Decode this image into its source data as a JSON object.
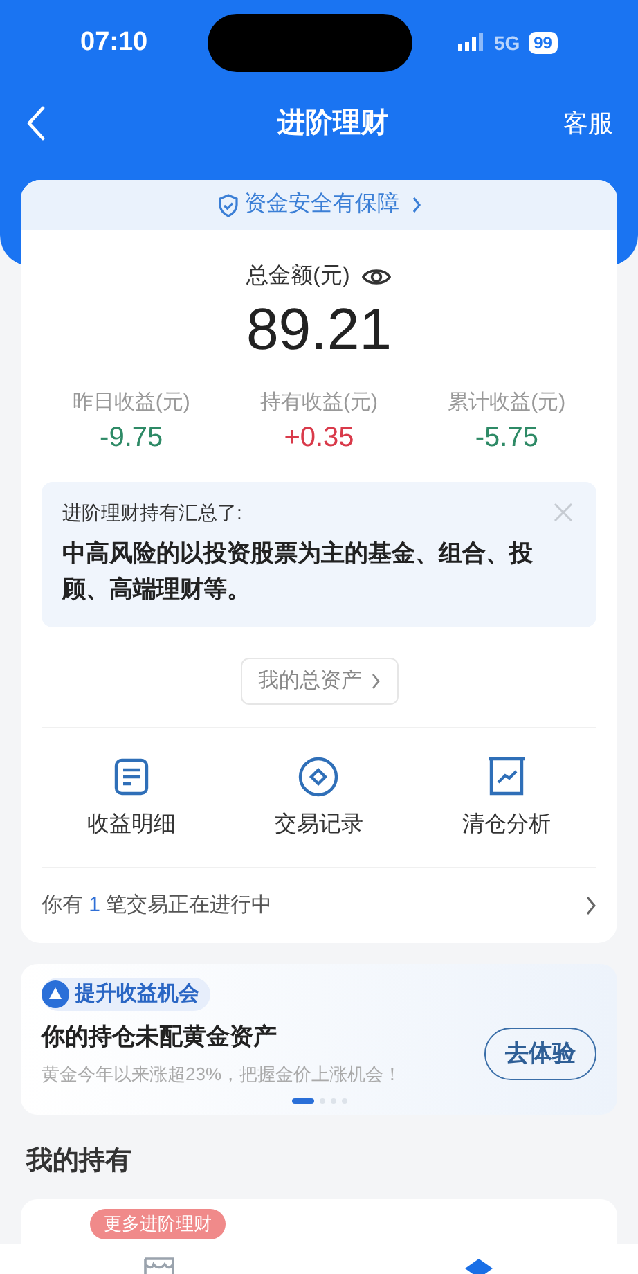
{
  "status_bar": {
    "time": "07:10",
    "network": "5G",
    "battery": "99"
  },
  "nav": {
    "title": "进阶理财",
    "action": "客服"
  },
  "summary": {
    "banner": "资金安全有保障",
    "total_label": "总金额(元)",
    "total": "89.21",
    "stats": [
      {
        "label": "昨日收益(元)",
        "value": "-9.75",
        "kind": "loss"
      },
      {
        "label": "持有收益(元)",
        "value": "+0.35",
        "kind": "gain"
      },
      {
        "label": "累计收益(元)",
        "value": "-5.75",
        "kind": "loss"
      }
    ]
  },
  "notice": {
    "title": "进阶理财持有汇总了:",
    "text": "中高风险的以投资股票为主的基金、组合、投顾、高端理财等。"
  },
  "assets_button": "我的总资产",
  "shortcuts": [
    {
      "label": "收益明细",
      "kind": "document"
    },
    {
      "label": "交易记录",
      "kind": "record"
    },
    {
      "label": "清仓分析",
      "kind": "chart"
    }
  ],
  "pending": {
    "prefix": "你有",
    "count": "1",
    "suffix": "笔交易正在进行中"
  },
  "promo": {
    "tag": "提升收益机会",
    "title": "你的持仓未配黄金资产",
    "subtitle": "黄金今年以来涨超23%，把握金价上涨机会！",
    "button": "去体验",
    "dots": [
      {
        "selected": true
      },
      {
        "selected": false
      },
      {
        "selected": false
      },
      {
        "selected": false
      }
    ]
  },
  "holdings": {
    "title": "我的持有",
    "badge": "更多进阶理财"
  },
  "tab_bar": {
    "items": [
      {
        "kind": "store",
        "selected": false
      },
      {
        "kind": "diamond",
        "selected": true
      }
    ]
  }
}
